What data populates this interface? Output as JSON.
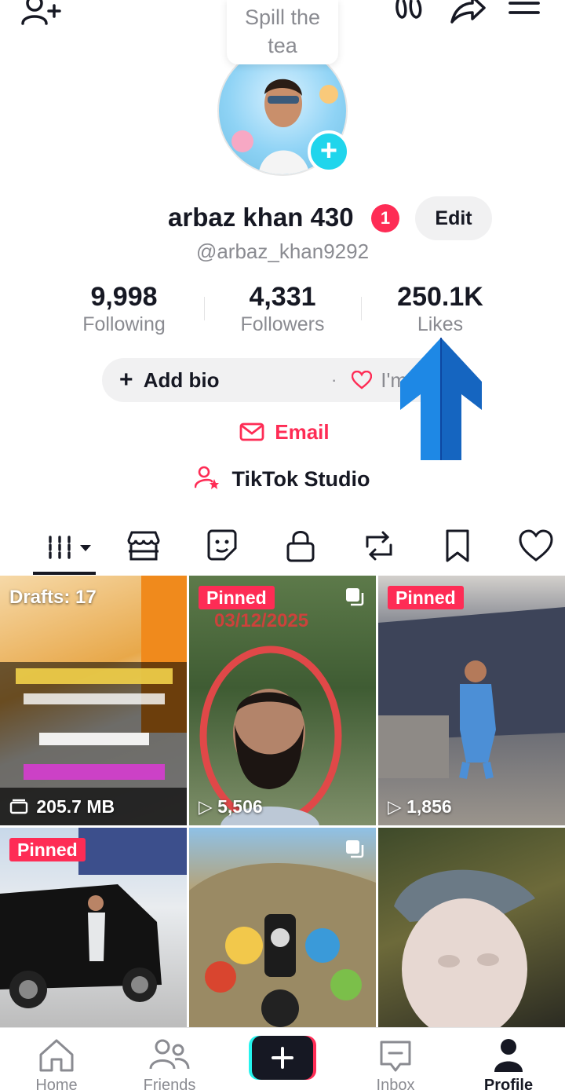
{
  "bubble": {
    "line1": "Spill the",
    "line2": "tea"
  },
  "profile": {
    "name": "arbaz khan 430",
    "badge_count": "1",
    "edit_label": "Edit",
    "handle": "@arbaz_khan9292"
  },
  "stats": [
    {
      "value": "9,998",
      "label": "Following"
    },
    {
      "value": "4,331",
      "label": "Followers"
    },
    {
      "value": "250.1K",
      "label": "Likes"
    }
  ],
  "bio": {
    "add_label": "Add bio",
    "separator": "·",
    "interest_label": "I'm interested"
  },
  "email_label": "Email",
  "studio_label": "TikTok Studio",
  "tabs": [
    "videos-grid",
    "shop",
    "sticker",
    "private",
    "reposts",
    "favorites",
    "liked"
  ],
  "grid": [
    {
      "kind": "drafts",
      "label": "Drafts: 17",
      "footer": "205.7 MB"
    },
    {
      "kind": "video",
      "badge": "Pinned",
      "overlay": "03/12/2025",
      "views": "5,506"
    },
    {
      "kind": "video",
      "badge": "Pinned",
      "views": "1,856"
    },
    {
      "kind": "video",
      "badge": "Pinned"
    },
    {
      "kind": "video"
    },
    {
      "kind": "video"
    }
  ],
  "nav": {
    "home": "Home",
    "friends": "Friends",
    "inbox": "Inbox",
    "profile": "Profile"
  },
  "colors": {
    "accent": "#fe2c55",
    "cyan": "#20d5ec",
    "text": "#161823",
    "muted": "#8a8b91"
  }
}
